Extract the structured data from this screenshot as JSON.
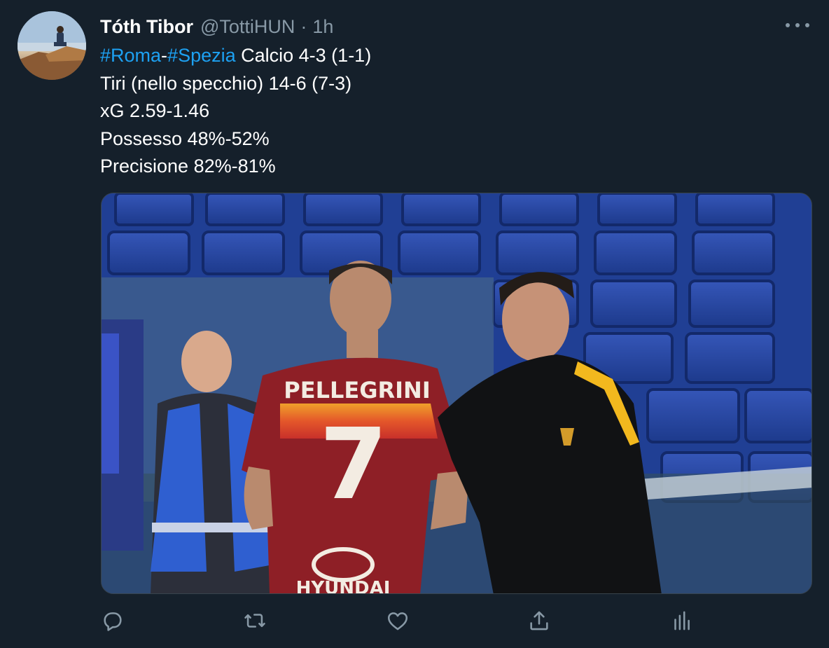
{
  "tweet": {
    "author_name": "Tóth Tibor",
    "handle": "@TottiHUN",
    "separator": "·",
    "timestamp": "1h",
    "line1": {
      "hashtag1": "#Roma",
      "dash": "-",
      "hashtag2": "#Spezia",
      "rest": " Calcio 4-3 (1-1)"
    },
    "line2": "Tiri (nello specchio) 14-6 (7-3)",
    "line3": "xG 2.59-1.46",
    "line4": "Possesso 48%-52%",
    "line5": "Precisione 82%-81%"
  },
  "media": {
    "jersey_name": "PELLEGRINI",
    "jersey_number": "7",
    "sponsor": "HYUNDAI"
  },
  "actions": [
    {
      "name": "reply",
      "icon": "reply-icon"
    },
    {
      "name": "retweet",
      "icon": "retweet-icon"
    },
    {
      "name": "like",
      "icon": "heart-icon"
    },
    {
      "name": "share",
      "icon": "share-icon"
    },
    {
      "name": "analytics",
      "icon": "analytics-icon"
    }
  ],
  "colors": {
    "background": "#15202b",
    "text": "#ffffff",
    "secondary": "#8899a6",
    "link": "#1da1f2"
  }
}
